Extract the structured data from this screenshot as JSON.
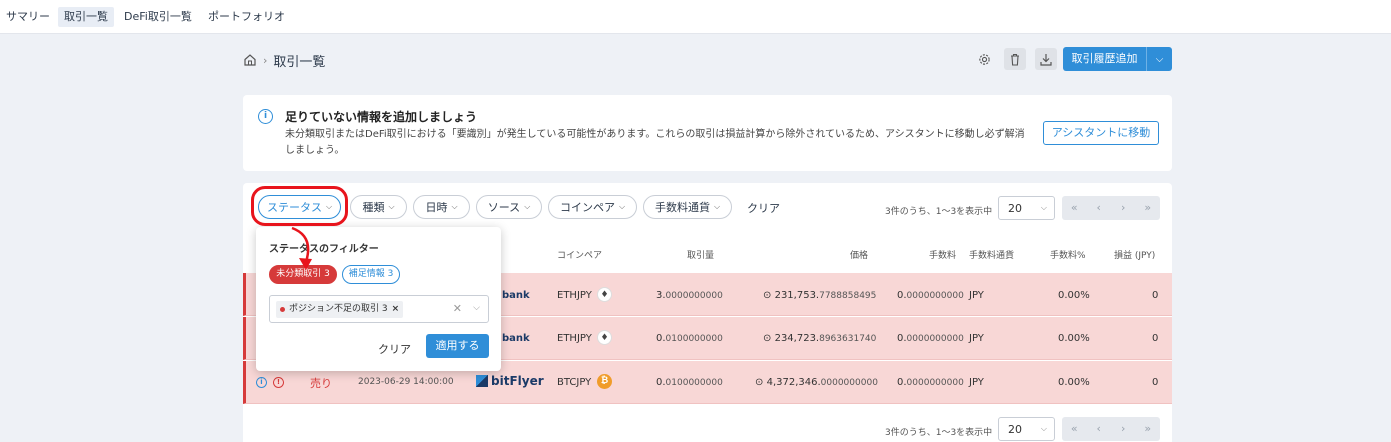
{
  "nav": {
    "tabs": [
      {
        "label": "サマリー",
        "active": false
      },
      {
        "label": "取引一覧",
        "active": true
      },
      {
        "label": "DeFi取引一覧",
        "active": false
      },
      {
        "label": "ポートフォリオ",
        "active": false
      }
    ]
  },
  "breadcrumb": {
    "home_icon": "home-icon",
    "page": "取引一覧"
  },
  "toolbar": {
    "settings_icon": "gear-icon",
    "delete_icon": "trash-icon",
    "download_icon": "download-icon",
    "add_label": "取引履歴追加"
  },
  "notice": {
    "title": "足りていない情報を追加しましょう",
    "body": "未分類取引またはDeFi取引における「要識別」が発生している可能性があります。これらの取引は損益計算から除外されているため、アシスタントに移動し必ず解消しましょう。",
    "button": "アシスタントに移動"
  },
  "filters": {
    "status": "ステータス",
    "kind": "種類",
    "datetime": "日時",
    "source": "ソース",
    "pair": "コインペア",
    "fee_currency": "手数料通貨",
    "clear": "クリア"
  },
  "pagination": {
    "info": "3件のうち、1～3を表示中",
    "per_page": "20",
    "first": "«",
    "prev": "‹",
    "next": "›",
    "last": "»"
  },
  "table": {
    "headers": [
      "コインペア",
      "取引量",
      "価格",
      "手数料",
      "手数料通貨",
      "手数料%",
      "損益 (JPY)"
    ],
    "rows": [
      {
        "side": "",
        "date": "",
        "source": "bank",
        "pair": "ETHJPY",
        "amount_main": "3.",
        "amount_frac": "0000000000",
        "price_main": "231,753.",
        "price_frac": "7788858495",
        "fee_main": "0.",
        "fee_frac": "0000000000",
        "fee_currency": "JPY",
        "fee_pct": "0.00%",
        "pnl": "0"
      },
      {
        "side": "",
        "date": "",
        "source": "bank",
        "pair": "ETHJPY",
        "amount_main": "0.",
        "amount_frac": "0100000000",
        "price_main": "234,723.",
        "price_frac": "8963631740",
        "fee_main": "0.",
        "fee_frac": "0000000000",
        "fee_currency": "JPY",
        "fee_pct": "0.00%",
        "pnl": "0"
      },
      {
        "side": "売り",
        "date": "2023-06-29 14:00:00",
        "source": "bitFlyer",
        "pair": "BTCJPY",
        "amount_main": "0.",
        "amount_frac": "0100000000",
        "price_main": "4,372,346.",
        "price_frac": "0000000000",
        "fee_main": "0.",
        "fee_frac": "0000000000",
        "fee_currency": "JPY",
        "fee_pct": "0.00%",
        "pnl": "0"
      }
    ]
  },
  "status_dropdown": {
    "title": "ステータスのフィルター",
    "pill_unclassified": "未分類取引 3",
    "pill_supplement": "補足情報 3",
    "tag": "ポジション不足の取引  3",
    "clear": "クリア",
    "apply": "適用する"
  },
  "colors": {
    "accent": "#2f8ed8",
    "error_row": "#f8d7d6",
    "error": "#d63a3a",
    "highlight": "#e8141c"
  }
}
